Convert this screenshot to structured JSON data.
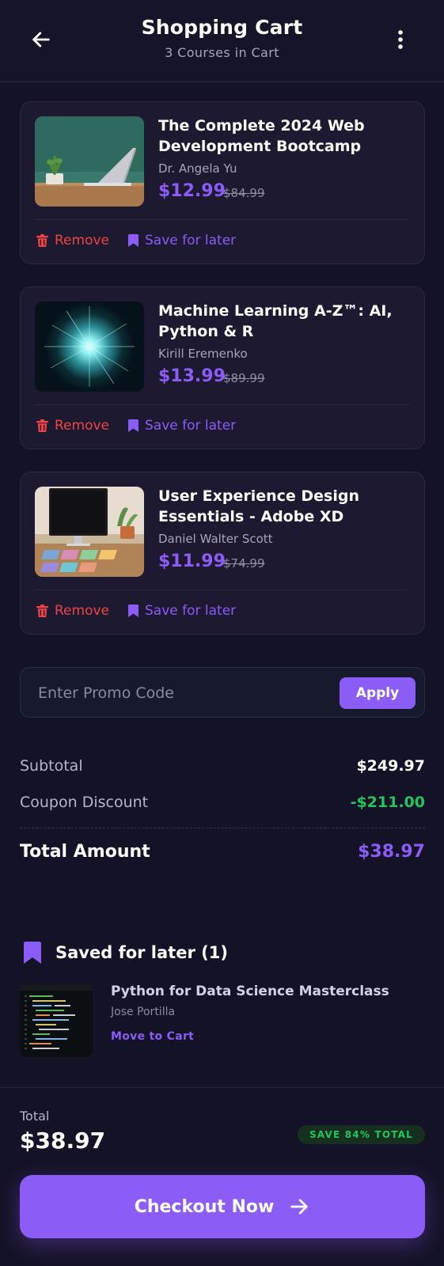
{
  "header": {
    "title": "Shopping Cart",
    "subtitle": "3 Courses in Cart"
  },
  "cart": [
    {
      "title": "The Complete 2024 Web Development Bootcamp",
      "author": "Dr. Angela Yu",
      "price": "$12.99",
      "old_price": "$84.99",
      "remove_label": "Remove",
      "save_label": "Save for later"
    },
    {
      "title": "Machine Learning A-Z™: AI, Python & R",
      "author": "Kirill Eremenko",
      "price": "$13.99",
      "old_price": "$89.99",
      "remove_label": "Remove",
      "save_label": "Save for later"
    },
    {
      "title": "User Experience Design Essentials - Adobe XD",
      "author": "Daniel Walter Scott",
      "price": "$11.99",
      "old_price": "$74.99",
      "remove_label": "Remove",
      "save_label": "Save for later"
    }
  ],
  "promo": {
    "placeholder": "Enter Promo Code",
    "value": "",
    "apply_label": "Apply"
  },
  "summary": {
    "subtotal_label": "Subtotal",
    "subtotal_value": "$249.97",
    "discount_label": "Coupon Discount",
    "discount_value": "-$211.00",
    "total_label": "Total Amount",
    "total_value": "$38.97"
  },
  "saved": {
    "heading": "Saved for later (1)",
    "items": [
      {
        "title": "Python for Data Science Masterclass",
        "author": "Jose Portilla",
        "move_label": "Move to Cart"
      }
    ]
  },
  "footer": {
    "total_label": "Total",
    "total_value": "$38.97",
    "save_badge": "SAVE 84% TOTAL",
    "checkout_label": "Checkout Now"
  },
  "icons": {
    "back": "arrow-left-icon",
    "menu": "more-vertical-icon",
    "remove": "trash-icon",
    "save": "bookmark-icon",
    "saved_heading": "bookmark-icon",
    "checkout": "arrow-right-icon"
  },
  "colors": {
    "background": "#141226",
    "card": "#1c1930",
    "accent": "#8b5cf6",
    "danger": "#ef4444",
    "success": "#22c55e"
  }
}
